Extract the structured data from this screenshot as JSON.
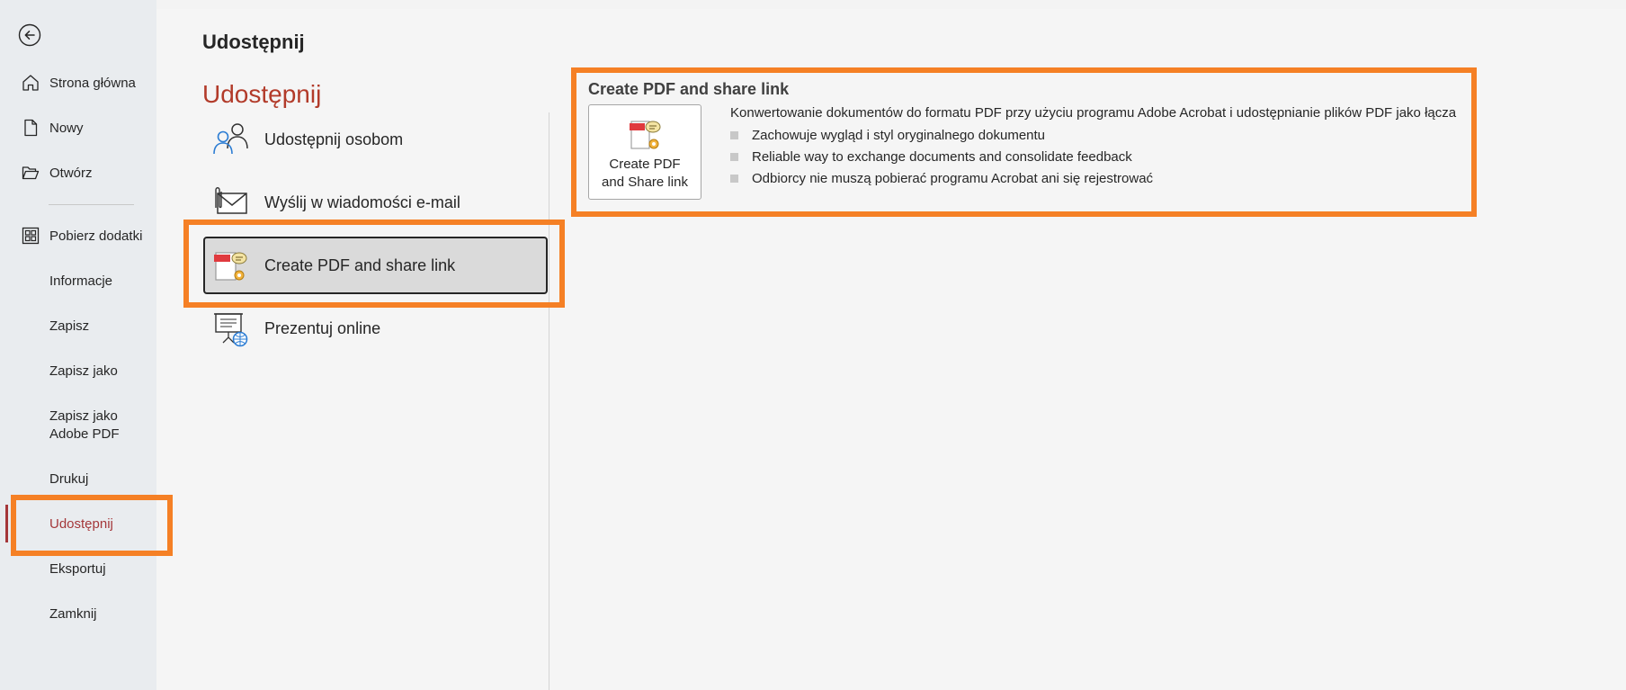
{
  "sidebar": {
    "back_icon": "arrow-left-circle-icon",
    "items": [
      {
        "label": "Strona główna",
        "icon": "home-icon"
      },
      {
        "label": "Nowy",
        "icon": "document-icon"
      },
      {
        "label": "Otwórz",
        "icon": "folder-open-icon"
      },
      {
        "label": "Pobierz dodatki",
        "icon": "grid-apps-icon"
      },
      {
        "label": "Informacje"
      },
      {
        "label": "Zapisz"
      },
      {
        "label": "Zapisz jako"
      },
      {
        "label": "Zapisz jako Adobe PDF"
      },
      {
        "label": "Drukuj"
      },
      {
        "label": "Udostępnij",
        "active": true
      },
      {
        "label": "Eksportuj"
      },
      {
        "label": "Zamknij"
      }
    ]
  },
  "main": {
    "page_title": "Udostępnij",
    "section_title": "Udostępnij",
    "options": [
      {
        "label": "Udostępnij osobom",
        "icon": "people-share-icon"
      },
      {
        "label": "Wyślij w wiadomości e-mail",
        "icon": "email-attachment-icon"
      },
      {
        "label": "Create PDF and share link",
        "icon": "pdf-share-icon",
        "selected": true
      },
      {
        "label": "Prezentuj online",
        "icon": "present-online-icon"
      }
    ]
  },
  "detail": {
    "title": "Create PDF and share link",
    "button_label_line1": "Create PDF",
    "button_label_line2": "and Share link",
    "description": "Konwertowanie dokumentów do formatu PDF przy użyciu programu Adobe Acrobat i udostępnianie plików PDF jako łącza",
    "bullets": [
      "Zachowuje wygląd i styl oryginalnego dokumentu",
      "Reliable way to exchange documents and consolidate feedback",
      "Odbiorcy nie muszą pobierać programu Acrobat ani się rejestrować"
    ]
  },
  "colors": {
    "accent": "#a4373a",
    "highlight": "#f58025"
  }
}
